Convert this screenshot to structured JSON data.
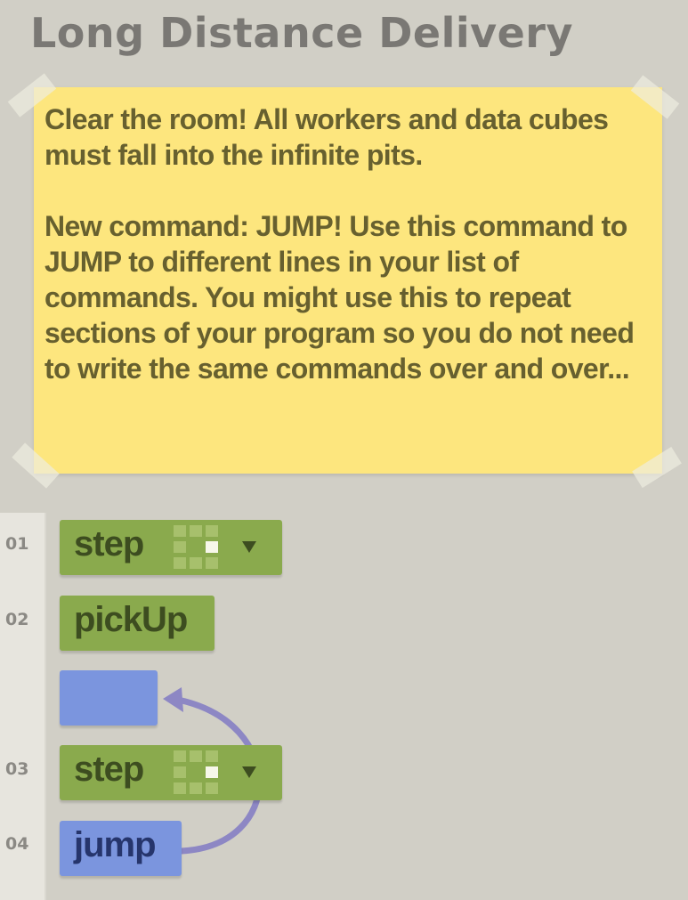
{
  "title": "Long Distance Delivery",
  "instructions": {
    "paragraph_1": "Clear the room! All workers and data cubes must fall into the infinite pits.",
    "paragraph_2": "New command: JUMP! Use this command to JUMP to different lines in your list of commands. You might use this to repeat sections of your program so you do not need to write the same commands over and over..."
  },
  "program": {
    "line_numbers": [
      "01",
      "02",
      "03",
      "04"
    ],
    "commands": [
      {
        "label": "step",
        "direction": "right"
      },
      {
        "label": "pickUp"
      },
      {
        "label": "step",
        "direction": "right"
      },
      {
        "label": "jump"
      }
    ]
  },
  "colors": {
    "background": "#d1cfc6",
    "note": "#fde67e",
    "command_green": "#8aaa4d",
    "command_blue": "#7b95de",
    "jump_arrow": "#8d87c4"
  },
  "icons": {
    "direction_selector": "direction-grid-icon",
    "dropdown": "triangle-down-icon"
  }
}
